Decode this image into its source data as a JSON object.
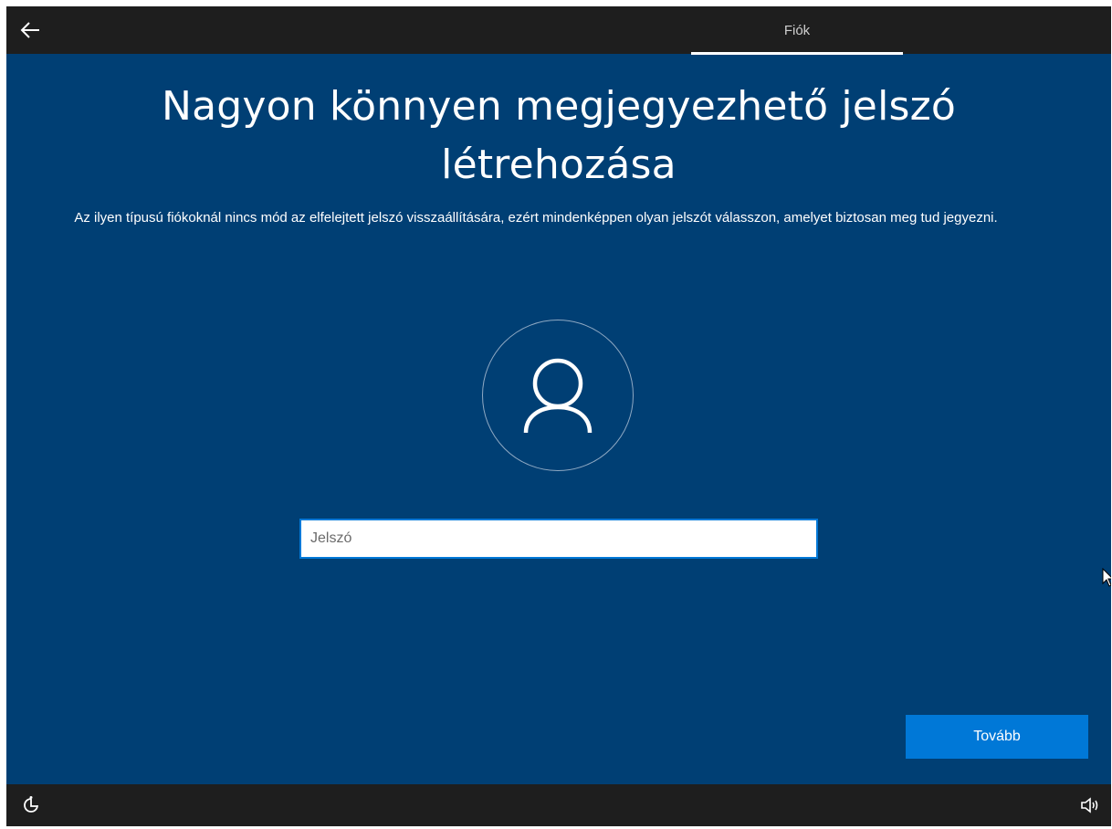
{
  "topbar": {
    "back_icon": "back-arrow-icon",
    "active_tab": "Fiók"
  },
  "main": {
    "title": "Nagyon könnyen megjegyezhető jelszó létrehozása",
    "subtitle": "Az ilyen típusú fiókoknál nincs mód az elfelejtett jelszó visszaállítására, ezért mindenképpen olyan jelszót válasszon, amelyet biztosan meg tud jegyezni.",
    "avatar_icon": "user-icon",
    "password": {
      "value": "",
      "placeholder": "Jelszó"
    },
    "next_label": "Tovább"
  },
  "bottombar": {
    "left_icon": "ease-of-access-icon",
    "right_icon": "volume-icon"
  },
  "colors": {
    "background": "#003f74",
    "bar": "#1e1e1e",
    "accent": "#0078d7"
  }
}
